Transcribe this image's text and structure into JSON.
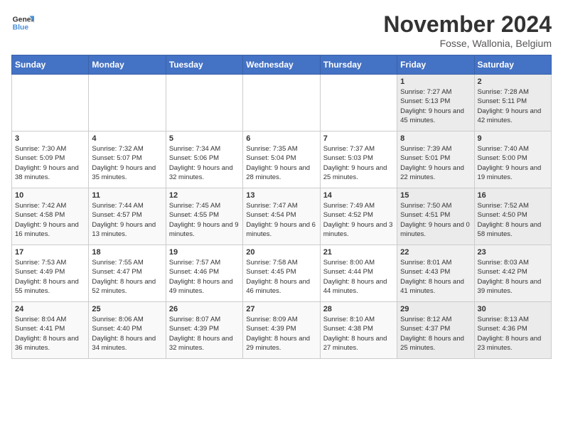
{
  "logo": {
    "line1": "General",
    "line2": "Blue"
  },
  "title": "November 2024",
  "subtitle": "Fosse, Wallonia, Belgium",
  "weekdays": [
    "Sunday",
    "Monday",
    "Tuesday",
    "Wednesday",
    "Thursday",
    "Friday",
    "Saturday"
  ],
  "weeks": [
    [
      {
        "day": "",
        "info": ""
      },
      {
        "day": "",
        "info": ""
      },
      {
        "day": "",
        "info": ""
      },
      {
        "day": "",
        "info": ""
      },
      {
        "day": "",
        "info": ""
      },
      {
        "day": "1",
        "info": "Sunrise: 7:27 AM\nSunset: 5:13 PM\nDaylight: 9 hours and 45 minutes."
      },
      {
        "day": "2",
        "info": "Sunrise: 7:28 AM\nSunset: 5:11 PM\nDaylight: 9 hours and 42 minutes."
      }
    ],
    [
      {
        "day": "3",
        "info": "Sunrise: 7:30 AM\nSunset: 5:09 PM\nDaylight: 9 hours and 38 minutes."
      },
      {
        "day": "4",
        "info": "Sunrise: 7:32 AM\nSunset: 5:07 PM\nDaylight: 9 hours and 35 minutes."
      },
      {
        "day": "5",
        "info": "Sunrise: 7:34 AM\nSunset: 5:06 PM\nDaylight: 9 hours and 32 minutes."
      },
      {
        "day": "6",
        "info": "Sunrise: 7:35 AM\nSunset: 5:04 PM\nDaylight: 9 hours and 28 minutes."
      },
      {
        "day": "7",
        "info": "Sunrise: 7:37 AM\nSunset: 5:03 PM\nDaylight: 9 hours and 25 minutes."
      },
      {
        "day": "8",
        "info": "Sunrise: 7:39 AM\nSunset: 5:01 PM\nDaylight: 9 hours and 22 minutes."
      },
      {
        "day": "9",
        "info": "Sunrise: 7:40 AM\nSunset: 5:00 PM\nDaylight: 9 hours and 19 minutes."
      }
    ],
    [
      {
        "day": "10",
        "info": "Sunrise: 7:42 AM\nSunset: 4:58 PM\nDaylight: 9 hours and 16 minutes."
      },
      {
        "day": "11",
        "info": "Sunrise: 7:44 AM\nSunset: 4:57 PM\nDaylight: 9 hours and 13 minutes."
      },
      {
        "day": "12",
        "info": "Sunrise: 7:45 AM\nSunset: 4:55 PM\nDaylight: 9 hours and 9 minutes."
      },
      {
        "day": "13",
        "info": "Sunrise: 7:47 AM\nSunset: 4:54 PM\nDaylight: 9 hours and 6 minutes."
      },
      {
        "day": "14",
        "info": "Sunrise: 7:49 AM\nSunset: 4:52 PM\nDaylight: 9 hours and 3 minutes."
      },
      {
        "day": "15",
        "info": "Sunrise: 7:50 AM\nSunset: 4:51 PM\nDaylight: 9 hours and 0 minutes."
      },
      {
        "day": "16",
        "info": "Sunrise: 7:52 AM\nSunset: 4:50 PM\nDaylight: 8 hours and 58 minutes."
      }
    ],
    [
      {
        "day": "17",
        "info": "Sunrise: 7:53 AM\nSunset: 4:49 PM\nDaylight: 8 hours and 55 minutes."
      },
      {
        "day": "18",
        "info": "Sunrise: 7:55 AM\nSunset: 4:47 PM\nDaylight: 8 hours and 52 minutes."
      },
      {
        "day": "19",
        "info": "Sunrise: 7:57 AM\nSunset: 4:46 PM\nDaylight: 8 hours and 49 minutes."
      },
      {
        "day": "20",
        "info": "Sunrise: 7:58 AM\nSunset: 4:45 PM\nDaylight: 8 hours and 46 minutes."
      },
      {
        "day": "21",
        "info": "Sunrise: 8:00 AM\nSunset: 4:44 PM\nDaylight: 8 hours and 44 minutes."
      },
      {
        "day": "22",
        "info": "Sunrise: 8:01 AM\nSunset: 4:43 PM\nDaylight: 8 hours and 41 minutes."
      },
      {
        "day": "23",
        "info": "Sunrise: 8:03 AM\nSunset: 4:42 PM\nDaylight: 8 hours and 39 minutes."
      }
    ],
    [
      {
        "day": "24",
        "info": "Sunrise: 8:04 AM\nSunset: 4:41 PM\nDaylight: 8 hours and 36 minutes."
      },
      {
        "day": "25",
        "info": "Sunrise: 8:06 AM\nSunset: 4:40 PM\nDaylight: 8 hours and 34 minutes."
      },
      {
        "day": "26",
        "info": "Sunrise: 8:07 AM\nSunset: 4:39 PM\nDaylight: 8 hours and 32 minutes."
      },
      {
        "day": "27",
        "info": "Sunrise: 8:09 AM\nSunset: 4:39 PM\nDaylight: 8 hours and 29 minutes."
      },
      {
        "day": "28",
        "info": "Sunrise: 8:10 AM\nSunset: 4:38 PM\nDaylight: 8 hours and 27 minutes."
      },
      {
        "day": "29",
        "info": "Sunrise: 8:12 AM\nSunset: 4:37 PM\nDaylight: 8 hours and 25 minutes."
      },
      {
        "day": "30",
        "info": "Sunrise: 8:13 AM\nSunset: 4:36 PM\nDaylight: 8 hours and 23 minutes."
      }
    ]
  ]
}
